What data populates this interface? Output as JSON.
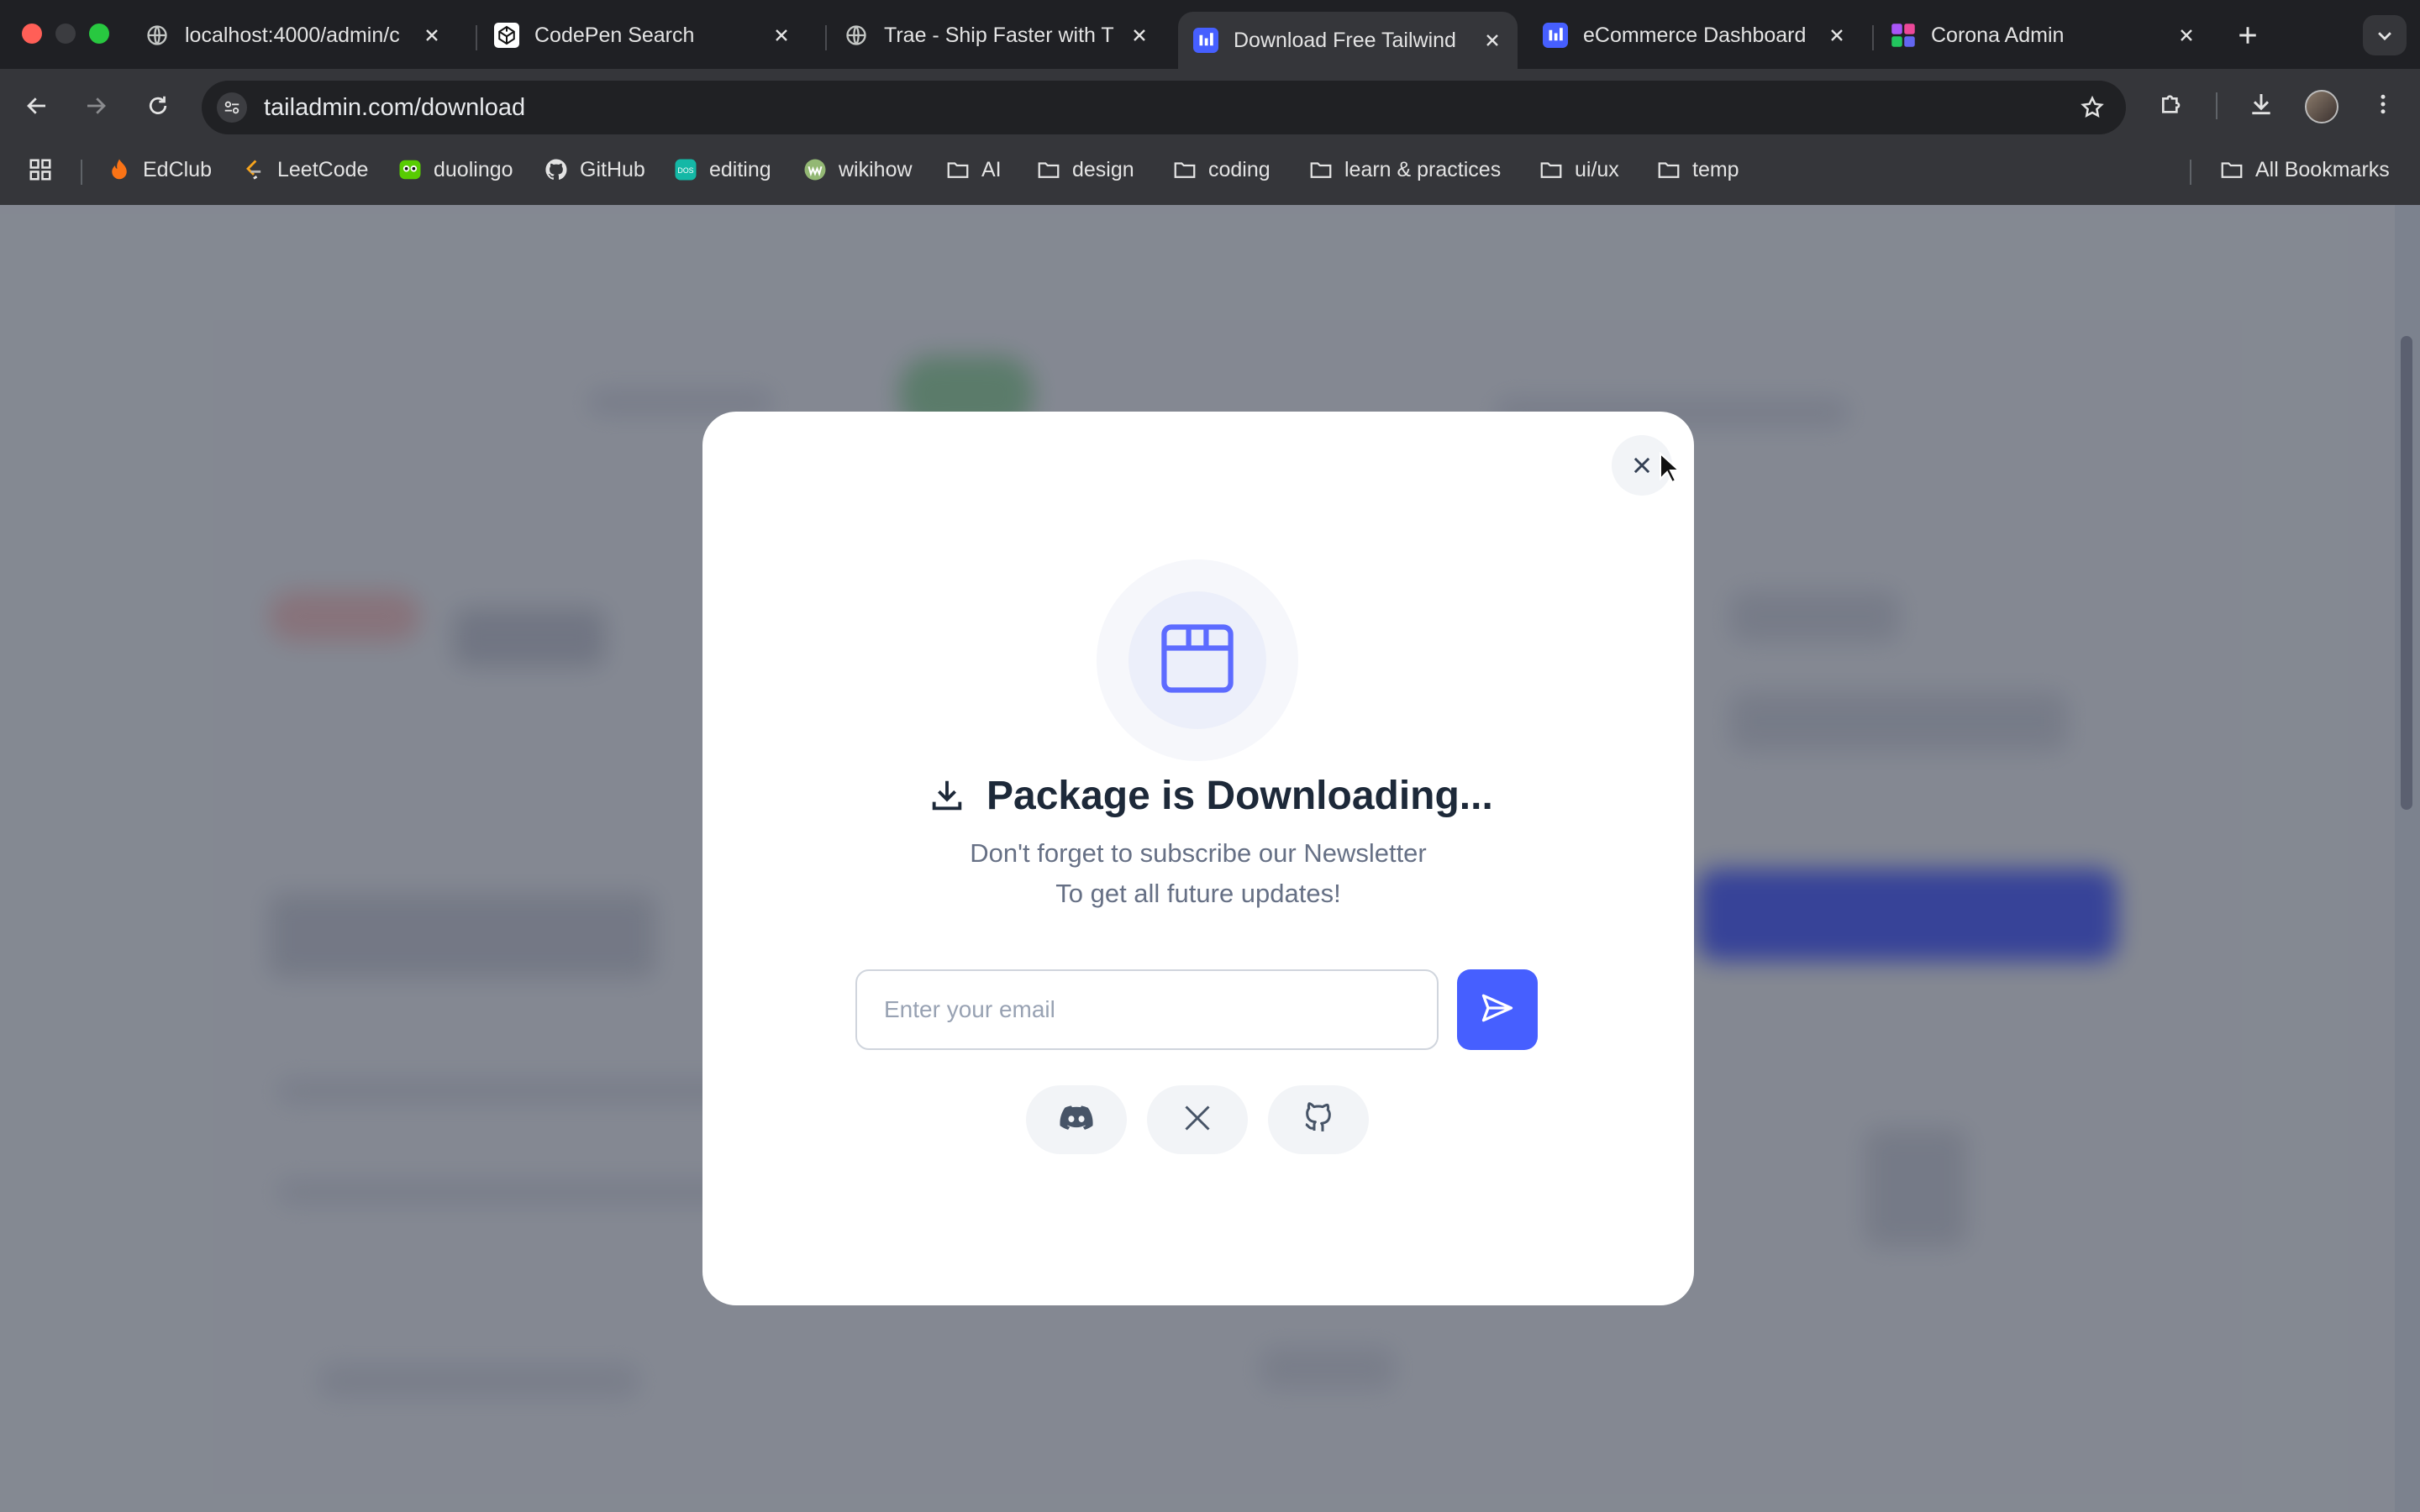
{
  "browser": {
    "tabs": [
      {
        "title": "localhost:4000/admin/c",
        "favicon": "globe-icon",
        "active": false
      },
      {
        "title": "CodePen Search",
        "favicon": "codepen-icon",
        "active": false
      },
      {
        "title": "Trae - Ship Faster with T",
        "favicon": "globe-icon",
        "active": false
      },
      {
        "title": "Download Free Tailwind",
        "favicon": "tailadmin-icon",
        "active": true
      },
      {
        "title": "eCommerce Dashboard",
        "favicon": "tailadmin-icon",
        "active": false
      },
      {
        "title": "Corona Admin",
        "favicon": "corona-icon",
        "active": false
      }
    ],
    "url": "tailadmin.com/download",
    "bookmarks": [
      {
        "label": "EdClub",
        "icon": "edclub-icon"
      },
      {
        "label": "LeetCode",
        "icon": "leetcode-icon"
      },
      {
        "label": "duolingo",
        "icon": "duolingo-icon"
      },
      {
        "label": "GitHub",
        "icon": "github-icon"
      },
      {
        "label": "editing",
        "icon": "docs-icon"
      },
      {
        "label": "wikihow",
        "icon": "wikihow-icon"
      },
      {
        "label": "AI",
        "icon": "folder-icon"
      },
      {
        "label": "design",
        "icon": "folder-icon"
      },
      {
        "label": "coding",
        "icon": "folder-icon"
      },
      {
        "label": "learn & practices",
        "icon": "folder-icon"
      },
      {
        "label": "ui/ux",
        "icon": "folder-icon"
      },
      {
        "label": "temp",
        "icon": "folder-icon"
      }
    ],
    "all_bookmarks_label": "All Bookmarks"
  },
  "modal": {
    "headline": "Package is Downloading...",
    "subtitle_line1": "Don't forget to subscribe our Newsletter",
    "subtitle_line2": "To get all future updates!",
    "email_placeholder": "Enter your email",
    "email_value": "",
    "socials": [
      "discord-icon",
      "x-icon",
      "github-icon"
    ]
  },
  "colors": {
    "accent": "#465fff",
    "package_icon": "#5d6bff",
    "heading": "#1d2939",
    "body_text": "#667085"
  }
}
